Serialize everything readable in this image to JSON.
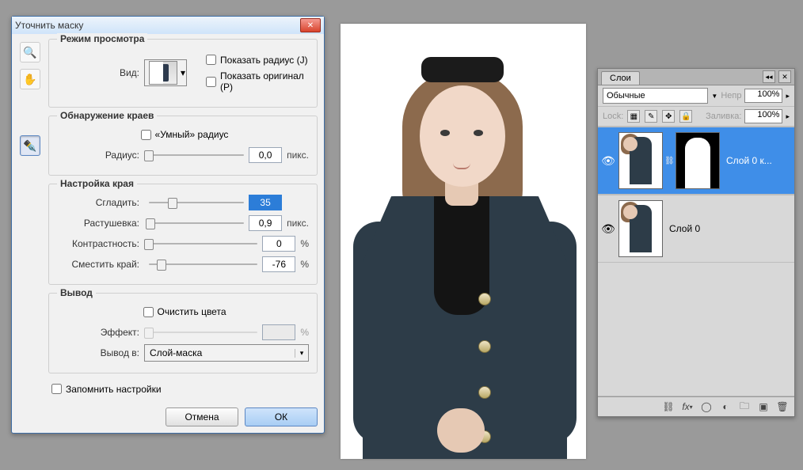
{
  "dialog": {
    "title": "Уточнить маску",
    "viewSection": {
      "legend": "Режим просмотра",
      "viewLabel": "Вид:",
      "showRadius": "Показать радиус (J)",
      "showOriginal": "Показать оригинал (P)"
    },
    "edgeDetect": {
      "legend": "Обнаружение краев",
      "smartRadius": "«Умный» радиус",
      "radiusLabel": "Радиус:",
      "radiusValue": "0,0",
      "radiusUnit": "пикс."
    },
    "edgeAdjust": {
      "legend": "Настройка края",
      "smooth": "Сгладить:",
      "smoothVal": "35",
      "feather": "Растушевка:",
      "featherVal": "0,9",
      "featherUnit": "пикс.",
      "contrast": "Контрастность:",
      "contrastVal": "0",
      "contrastUnit": "%",
      "shift": "Сместить край:",
      "shiftVal": "-76",
      "shiftUnit": "%"
    },
    "output": {
      "legend": "Вывод",
      "decontaminate": "Очистить цвета",
      "effect": "Эффект:",
      "effectUnit": "%",
      "outTo": "Вывод в:",
      "outSel": "Слой-маска"
    },
    "remember": "Запомнить настройки",
    "cancel": "Отмена",
    "ok": "ОК"
  },
  "layersPanel": {
    "tab": "Слои",
    "blendMode": "Обычные",
    "opacityLabel": "Непр",
    "opacityVal": "100%",
    "lockLabel": "Lock:",
    "fillLabel": "Заливка:",
    "fillVal": "100%",
    "layer0copy": "Слой 0 к...",
    "layer0": "Слой 0"
  }
}
